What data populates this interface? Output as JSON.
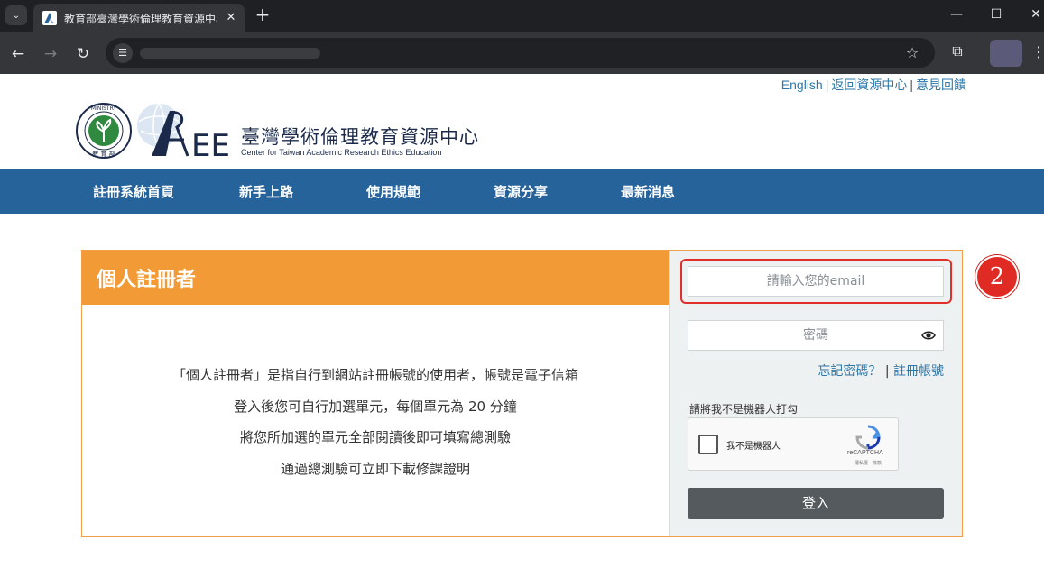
{
  "browser": {
    "tab_title": "教育部臺灣學術倫理教育資源中心",
    "tab_close": "✕",
    "new_tab": "+",
    "window_controls": {
      "minimize": "—",
      "maximize": "☐",
      "close": "✕"
    },
    "icons": {
      "tab_menu": "chevron-down-icon",
      "back": "arrow-left-icon",
      "forward": "arrow-right-icon",
      "reload": "reload-icon",
      "site_info": "tune-icon",
      "bookmark": "star-icon",
      "extensions": "puzzle-icon",
      "menu": "kebab-icon"
    }
  },
  "site": {
    "top_links": {
      "english": "English",
      "back_home": "返回資源中心",
      "feedback": "意見回饋"
    },
    "logo": {
      "title_zh": "臺灣學術倫理教育資源中心",
      "title_en": "Center for Taiwan Academic Research Ethics Education",
      "mark": "AREE",
      "seal_text": "MINISTRY OF EDUCATION",
      "seal_zh": "教育部"
    },
    "nav": [
      "註冊系統首頁",
      "新手上路",
      "使用規範",
      "資源分享",
      "最新消息"
    ],
    "panel": {
      "title": "個人註冊者",
      "description": [
        "「個人註冊者」是指自行到網站註冊帳號的使用者，帳號是電子信箱",
        "登入後您可自行加選單元，每個單元為 20 分鐘",
        "將您所加選的單元全部閱讀後即可填寫總測驗",
        "通過總測驗可立即下載修課證明"
      ]
    },
    "login": {
      "email_placeholder": "請輸入您的email",
      "password_placeholder": "密碼",
      "forgot_password": "忘記密碼？",
      "separator": "|",
      "register": "註冊帳號",
      "robot_prompt": "請將我不是機器人打勾",
      "recaptcha_label": "我不是機器人",
      "recaptcha_brand": "reCAPTCHA",
      "recaptcha_terms": "隱私權 - 條款",
      "submit": "登入"
    },
    "annotation_badge": "2"
  },
  "colors": {
    "nav_blue": "#26639a",
    "orange": "#f29a35",
    "highlight_red": "#e0302a",
    "link_blue": "#2e78a8",
    "login_button": "#555a5e"
  }
}
